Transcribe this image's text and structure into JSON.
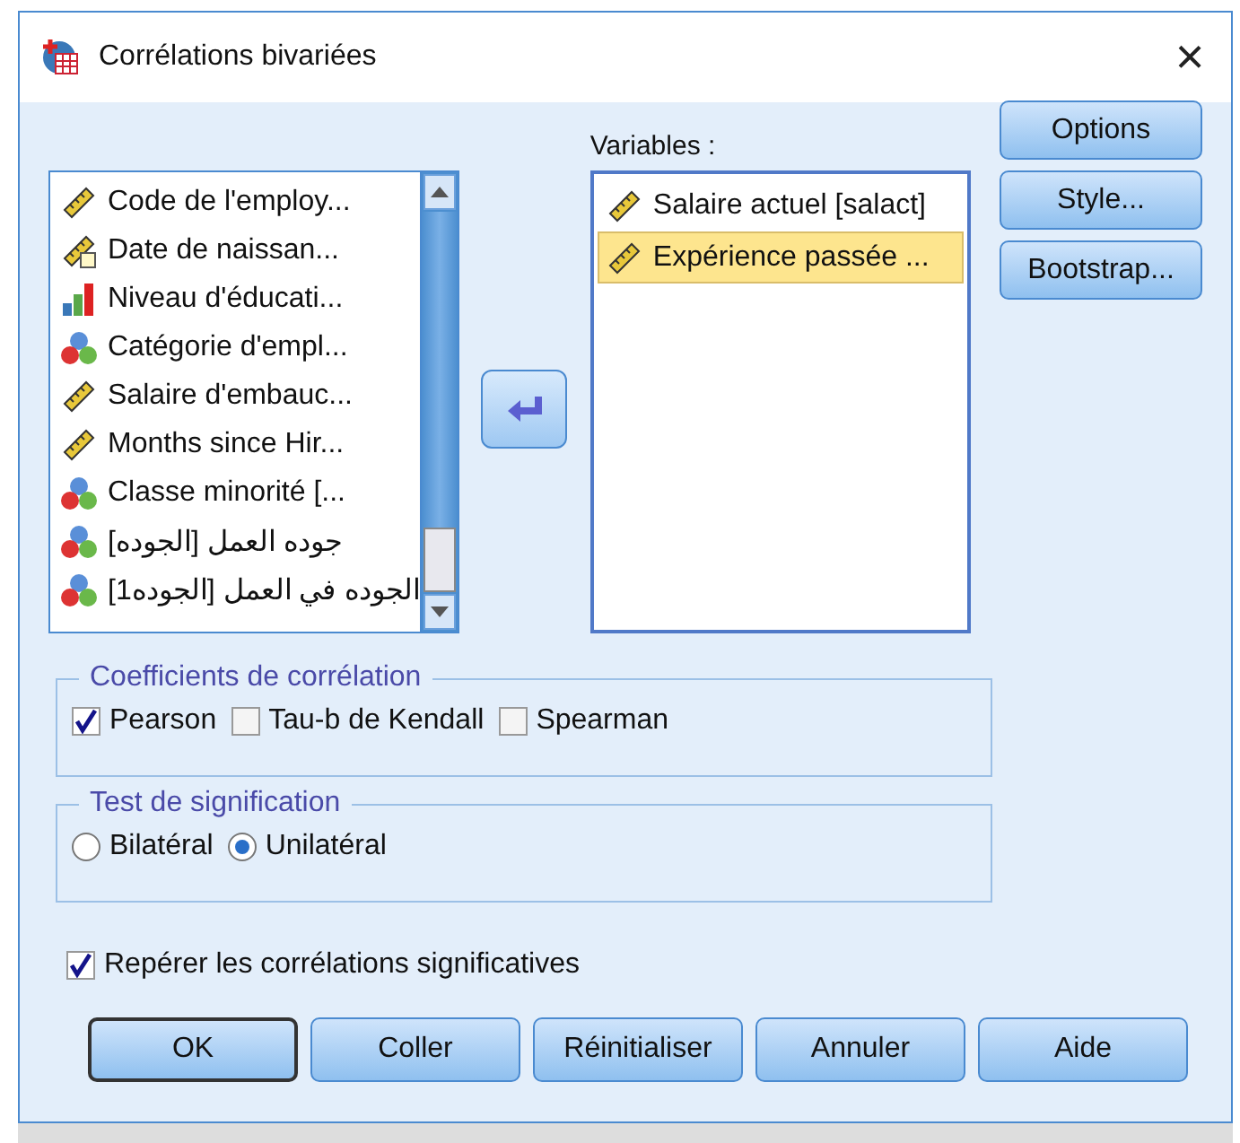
{
  "window": {
    "title": "Corrélations bivariées",
    "close": "×"
  },
  "source_list": {
    "items": [
      {
        "label": "Code de l'employ...",
        "kind": "scale"
      },
      {
        "label": "Date de naissan...",
        "kind": "date"
      },
      {
        "label": "Niveau d'éducati...",
        "kind": "ordinal"
      },
      {
        "label": "Catégorie d'empl...",
        "kind": "nominal"
      },
      {
        "label": "Salaire d'embauc...",
        "kind": "scale"
      },
      {
        "label": "Months since Hir...",
        "kind": "scale"
      },
      {
        "label": "Classe minorité [...",
        "kind": "nominal"
      },
      {
        "label": "جوده العمل [الجوده]",
        "kind": "nominal"
      },
      {
        "label": "الجوده في العمل [الجوده1]",
        "kind": "nominal"
      }
    ]
  },
  "variables": {
    "label": "Variables :",
    "items": [
      {
        "label": "Salaire actuel [salact]",
        "kind": "scale",
        "selected": false
      },
      {
        "label": "Expérience passée ...",
        "kind": "scale",
        "selected": true
      }
    ]
  },
  "side_buttons": [
    "Options",
    "Style...",
    "Bootstrap..."
  ],
  "coefficients": {
    "title": "Coefficients de corrélation",
    "options": [
      {
        "label": "Pearson",
        "checked": true
      },
      {
        "label": "Tau-b de Kendall",
        "checked": false
      },
      {
        "label": "Spearman",
        "checked": false
      }
    ]
  },
  "significance": {
    "title": "Test de signification",
    "options": [
      {
        "label": "Bilatéral",
        "selected": false
      },
      {
        "label": "Unilatéral",
        "selected": true
      }
    ]
  },
  "flag": {
    "label": "Repérer les corrélations significatives",
    "checked": true
  },
  "buttons": [
    {
      "label": "OK",
      "default": true
    },
    {
      "label": "Coller",
      "default": false
    },
    {
      "label": "Réinitialiser",
      "default": false
    },
    {
      "label": "Annuler",
      "default": false
    },
    {
      "label": "Aide",
      "default": false
    }
  ]
}
